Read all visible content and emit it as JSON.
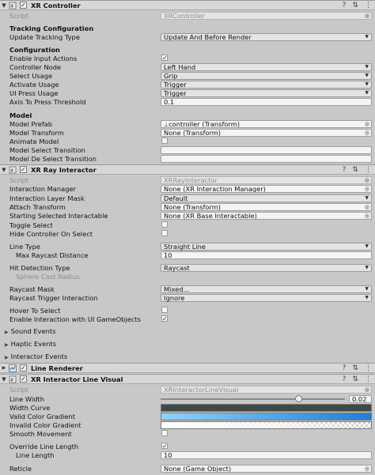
{
  "xr_controller": {
    "title": "XR Controller",
    "script_label": "Script",
    "script_value": "XRController",
    "section_tracking": "Tracking Configuration",
    "update_tracking_type_label": "Update Tracking Type",
    "update_tracking_type_value": "Update And Before Render",
    "section_configuration": "Configuration",
    "enable_input_actions_label": "Enable Input Actions",
    "enable_input_actions_checked": true,
    "controller_node_label": "Controller Node",
    "controller_node_value": "Left Hand",
    "select_usage_label": "Select Usage",
    "select_usage_value": "Grip",
    "activate_usage_label": "Activate Usage",
    "activate_usage_value": "Trigger",
    "ui_press_usage_label": "UI Press Usage",
    "ui_press_usage_value": "Trigger",
    "axis_threshold_label": "Axis To Press Threshold",
    "axis_threshold_value": "0.1",
    "section_model": "Model",
    "model_prefab_label": "Model Prefab",
    "model_prefab_value": "controller (Transform)",
    "model_transform_label": "Model Transform",
    "model_transform_value": "None (Transform)",
    "animate_model_label": "Animate Model",
    "model_select_transition_label": "Model Select Transition",
    "model_deselect_transition_label": "Model De Select Transition"
  },
  "xr_ray_interactor": {
    "title": "XR Ray Interactor",
    "script_label": "Script",
    "script_value": "XRRayInteractor",
    "interaction_manager_label": "Interaction Manager",
    "interaction_manager_value": "None (XR Interaction Manager)",
    "interaction_layer_mask_label": "Interaction Layer Mask",
    "interaction_layer_mask_value": "Default",
    "attach_transform_label": "Attach Transform",
    "attach_transform_value": "None (Transform)",
    "starting_selected_label": "Starting Selected Interactable",
    "starting_selected_value": "None (XR Base Interactable)",
    "toggle_select_label": "Toggle Select",
    "hide_controller_label": "Hide Controller On Select",
    "line_type_label": "Line Type",
    "line_type_value": "Straight Line",
    "max_raycast_label": "Max Raycast Distance",
    "max_raycast_value": "10",
    "hit_detection_label": "Hit Detection Type",
    "hit_detection_value": "Raycast",
    "sphere_cast_label": "Sphere Cast Radius",
    "raycast_mask_label": "Raycast Mask",
    "raycast_mask_value": "Mixed...",
    "raycast_trigger_label": "Raycast Trigger Interaction",
    "raycast_trigger_value": "Ignore",
    "hover_to_select_label": "Hover To Select",
    "enable_ui_label": "Enable Interaction with UI GameObjects",
    "enable_ui_checked": true,
    "sound_events_label": "Sound Events",
    "haptic_events_label": "Haptic Events",
    "interactor_events_label": "Interactor Events"
  },
  "line_renderer": {
    "title": "Line Renderer"
  },
  "xr_line_visual": {
    "title": "XR Interactor Line Visual",
    "script_label": "Script",
    "script_value": "XRInteractorLineVisual",
    "line_width_label": "Line Width",
    "line_width_value": "0.02",
    "line_width_fraction": 0.75,
    "width_curve_label": "Width Curve",
    "valid_gradient_label": "Valid Color Gradient",
    "invalid_gradient_label": "Invalid Color Gradient",
    "smooth_movement_label": "Smooth Movement",
    "override_length_label": "Override Line Length",
    "override_length_checked": true,
    "line_length_label": "Line Length",
    "line_length_value": "10",
    "reticle_label": "Reticle",
    "reticle_value": "None (Game Object)"
  },
  "colors": {
    "panel_bg": "#c8c8c8",
    "header_bg": "#d7d7d7",
    "width_curve": "#3f4a46",
    "valid_gradient_start": "#8fd3ff",
    "valid_gradient_end": "#1e7fd8"
  },
  "icons": {
    "fold": "triangle-down-icon",
    "script_icon": "cs-script-icon",
    "line_renderer_icon": "line-renderer-icon",
    "help": "help-icon",
    "preset": "preset-icon",
    "menu": "kebab-menu-icon",
    "object_picker": "target-icon",
    "dropdown": "chevron-down-icon"
  }
}
